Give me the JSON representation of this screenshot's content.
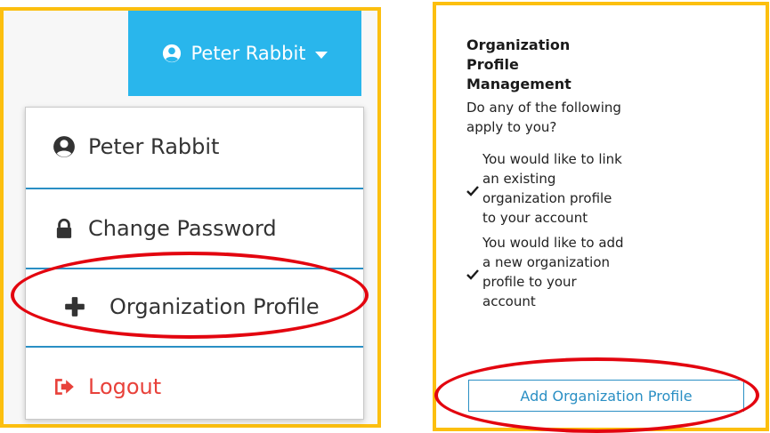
{
  "header": {
    "user_name": "Peter Rabbit"
  },
  "menu": {
    "items": [
      {
        "label": "Peter Rabbit",
        "icon": "user-circle-icon"
      },
      {
        "label": "Change Password",
        "icon": "lock-icon"
      },
      {
        "label": "Organization Profile",
        "icon": "plus-icon"
      },
      {
        "label": "Logout",
        "icon": "sign-out-icon"
      }
    ]
  },
  "side_panel": {
    "title": "Organization Profile Management",
    "question": "Do any of the following apply to you?",
    "items": [
      "You would like to link an existing organization profile to your account",
      "You would like to add a new organization profile to your account"
    ],
    "button_label": "Add Organization Profile"
  },
  "colors": {
    "highlight_border": "#fcbf0f",
    "annotation_oval": "#e3050f",
    "header_bg": "#29b6ec",
    "accent_blue": "#2a8fc4",
    "logout_red": "#e8413a"
  }
}
